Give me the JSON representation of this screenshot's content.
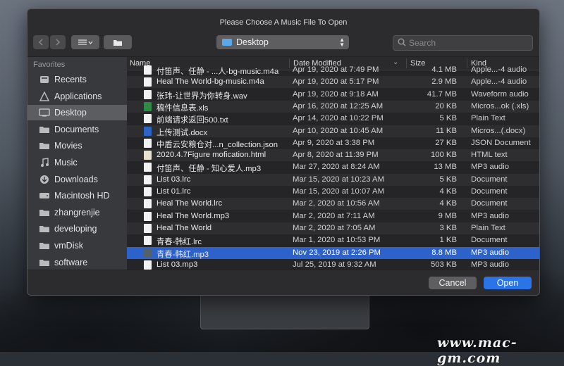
{
  "dialog": {
    "title": "Please Choose A Music File To Open"
  },
  "toolbar": {
    "back_icon": "chevron-left-icon",
    "forward_icon": "chevron-right-icon",
    "view_icon": "list-view-icon",
    "new_folder_icon": "new-folder-icon",
    "location": "Desktop",
    "search_placeholder": "Search"
  },
  "sidebar": {
    "heading": "Favorites",
    "items": [
      {
        "label": "Recents",
        "icon": "clock-icon"
      },
      {
        "label": "Applications",
        "icon": "applications-icon"
      },
      {
        "label": "Desktop",
        "icon": "desktop-icon",
        "selected": true
      },
      {
        "label": "Documents",
        "icon": "folder-icon"
      },
      {
        "label": "Movies",
        "icon": "folder-icon"
      },
      {
        "label": "Music",
        "icon": "music-icon"
      },
      {
        "label": "Downloads",
        "icon": "download-icon"
      },
      {
        "label": "Macintosh HD",
        "icon": "disk-icon"
      },
      {
        "label": "zhangrenjie",
        "icon": "folder-icon"
      },
      {
        "label": "developing",
        "icon": "folder-icon"
      },
      {
        "label": "vmDisk",
        "icon": "folder-icon"
      },
      {
        "label": "software",
        "icon": "folder-icon"
      }
    ]
  },
  "columns": {
    "name": "Name",
    "date": "Date Modified",
    "size": "Size",
    "kind": "Kind"
  },
  "files": [
    {
      "name": "付笛声、任静 - ...人-bg-music.m4a",
      "date": "Apr 19, 2020 at 7:49 PM",
      "size": "4.1 MB",
      "kind": "Apple...-4 audio",
      "type": "audio"
    },
    {
      "name": "Heal The World-bg-music.m4a",
      "date": "Apr 19, 2020 at 5:17 PM",
      "size": "2.9 MB",
      "kind": "Apple...-4 audio",
      "type": "audio"
    },
    {
      "name": "张玮-让世界为你转身.wav",
      "date": "Apr 19, 2020 at 9:18 AM",
      "size": "41.7 MB",
      "kind": "Waveform audio",
      "type": "audio"
    },
    {
      "name": "稿件信息表.xls",
      "date": "Apr 16, 2020 at 12:25 AM",
      "size": "20 KB",
      "kind": "Micros...ok (.xls)",
      "type": "xls"
    },
    {
      "name": "前端请求返回500.txt",
      "date": "Apr 14, 2020 at 10:22 PM",
      "size": "5 KB",
      "kind": "Plain Text",
      "type": "doc-plain"
    },
    {
      "name": "上传测试.docx",
      "date": "Apr 10, 2020 at 10:45 AM",
      "size": "11 KB",
      "kind": "Micros...(.docx)",
      "type": "doc"
    },
    {
      "name": "中盾云安粮仓对...n_collection.json",
      "date": "Apr 9, 2020 at 3:38 PM",
      "size": "27 KB",
      "kind": "JSON Document",
      "type": "doc-plain"
    },
    {
      "name": "2020.4.7Figure mofication.html",
      "date": "Apr 8, 2020 at 11:39 PM",
      "size": "100 KB",
      "kind": "HTML text",
      "type": "html"
    },
    {
      "name": "付笛声、任静 - 知心爱人.mp3",
      "date": "Mar 27, 2020 at 8:24 AM",
      "size": "13 MB",
      "kind": "MP3 audio",
      "type": "audio"
    },
    {
      "name": "List 03.lrc",
      "date": "Mar 15, 2020 at 10:23 AM",
      "size": "5 KB",
      "kind": "Document",
      "type": "doc-plain"
    },
    {
      "name": "List 01.lrc",
      "date": "Mar 15, 2020 at 10:07 AM",
      "size": "4 KB",
      "kind": "Document",
      "type": "doc-plain"
    },
    {
      "name": "Heal The World.lrc",
      "date": "Mar 2, 2020 at 10:56 AM",
      "size": "4 KB",
      "kind": "Document",
      "type": "doc-plain"
    },
    {
      "name": "Heal The World.mp3",
      "date": "Mar 2, 2020 at 7:11 AM",
      "size": "9 MB",
      "kind": "MP3 audio",
      "type": "doc-plain"
    },
    {
      "name": "Heal The World",
      "date": "Mar 2, 2020 at 7:05 AM",
      "size": "3 KB",
      "kind": "Plain Text",
      "type": "doc-plain"
    },
    {
      "name": "青春-韩红.lrc",
      "date": "Mar 1, 2020 at 10:53 PM",
      "size": "1 KB",
      "kind": "Document",
      "type": "doc-plain"
    },
    {
      "name": "青春-韩红.mp3",
      "date": "Nov 23, 2019 at 2:26 PM",
      "size": "8.8 MB",
      "kind": "MP3 audio",
      "type": "img",
      "selected": true
    },
    {
      "name": "List 03.mp3",
      "date": "Jul 25, 2019 at 9:32 AM",
      "size": "503 KB",
      "kind": "MP3 audio",
      "type": "audio"
    }
  ],
  "buttons": {
    "cancel": "Cancel",
    "open": "Open"
  },
  "watermark": "www.mac-gm.com"
}
